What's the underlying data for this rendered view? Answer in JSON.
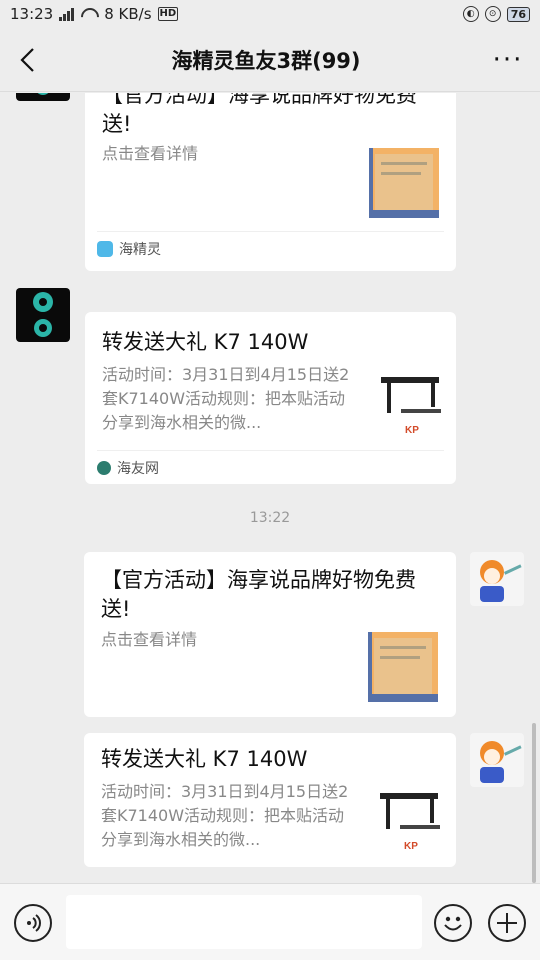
{
  "status_bar": {
    "time": "13:23",
    "net_speed": "8 KB/s",
    "hd": "HD",
    "battery": "76"
  },
  "header": {
    "title": "海精灵鱼友3群(99)",
    "more": "···"
  },
  "messages": [
    {
      "title": "【官方活动】海享说品牌好物免费送!",
      "desc": "点击查看详情",
      "source": "海精灵"
    },
    {
      "title": "转发送大礼 K7 140W",
      "desc": "活动时间：3月31日到4月15日送2套K7140W活动规则：把本贴活动分享到海水相关的微...",
      "source": "海友网"
    },
    {
      "title": "【官方活动】海享说品牌好物免费送!",
      "desc": "点击查看详情"
    },
    {
      "title": "转发送大礼 K7 140W",
      "desc": "活动时间：3月31日到4月15日送2套K7140W活动规则：把本贴活动分享到海水相关的微..."
    }
  ],
  "timestamp": "13:22",
  "colors": {
    "background": "#ededed",
    "card": "#ffffff",
    "source_icon": "#3aa3e3"
  },
  "icons": [
    "back-arrow-icon",
    "more-icon",
    "voice-icon",
    "emoji-icon",
    "plus-icon"
  ]
}
